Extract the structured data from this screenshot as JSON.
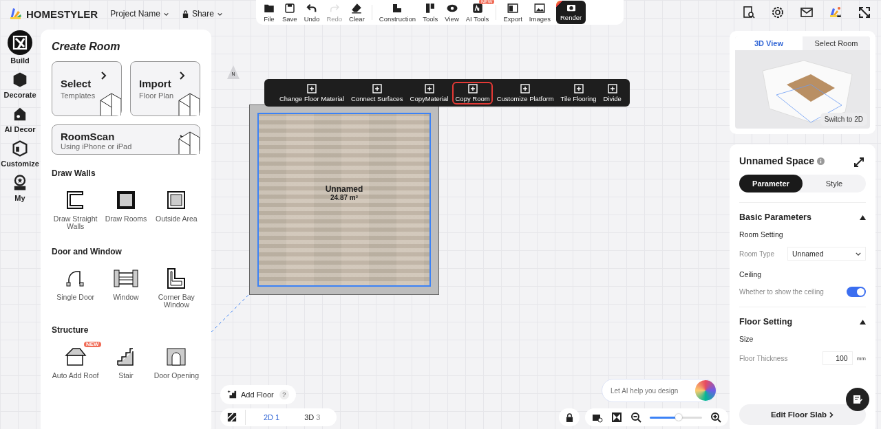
{
  "header": {
    "brand": "HOMESTYLER",
    "project": "Project Name",
    "share": "Share"
  },
  "toolbar": [
    {
      "label": "File",
      "disabled": false,
      "kind": "tool"
    },
    {
      "label": "Save",
      "disabled": false,
      "kind": "tool"
    },
    {
      "label": "Undo",
      "disabled": false,
      "kind": "tool"
    },
    {
      "label": "Redo",
      "disabled": true,
      "kind": "tool"
    },
    {
      "label": "Clear",
      "disabled": false,
      "kind": "tool"
    },
    {
      "label": "Construction",
      "disabled": false,
      "kind": "tool"
    },
    {
      "label": "Tools",
      "disabled": false,
      "kind": "tool"
    },
    {
      "label": "View",
      "disabled": false,
      "kind": "tool"
    },
    {
      "label": "AI Tools",
      "disabled": false,
      "kind": "tool",
      "badge": "NEW"
    },
    {
      "label": "Export",
      "disabled": false,
      "kind": "tool"
    },
    {
      "label": "Images",
      "disabled": false,
      "kind": "tool"
    },
    {
      "label": "Render",
      "disabled": false,
      "kind": "render"
    }
  ],
  "nav": [
    {
      "label": "Build",
      "selected": true
    },
    {
      "label": "Decorate",
      "selected": false
    },
    {
      "label": "AI Decor",
      "selected": false
    },
    {
      "label": "Customize",
      "selected": false
    },
    {
      "label": "My",
      "selected": false
    }
  ],
  "panel": {
    "title": "Create Room",
    "cards": [
      {
        "title": "Select",
        "subtitle": "Templates"
      },
      {
        "title": "Import",
        "subtitle": "Floor Plan"
      },
      {
        "title": "RoomScan",
        "subtitle": "Using iPhone or iPad"
      }
    ],
    "sections": [
      {
        "title": "Draw Walls",
        "items": [
          {
            "label": "Draw Straight Walls"
          },
          {
            "label": "Draw Rooms"
          },
          {
            "label": "Outside Area"
          }
        ]
      },
      {
        "title": "Door and Window",
        "items": [
          {
            "label": "Single Door"
          },
          {
            "label": "Window"
          },
          {
            "label": "Corner Bay Window"
          }
        ]
      },
      {
        "title": "Structure",
        "items": [
          {
            "label": "Auto Add Roof",
            "badge": "NEW"
          },
          {
            "label": "Stair"
          },
          {
            "label": "Door Opening"
          }
        ]
      }
    ]
  },
  "canvas": {
    "compass": "N",
    "room": {
      "name": "Unnamed",
      "area": "24.87 m²"
    },
    "context_toolbar": [
      {
        "label": "Change Floor Material",
        "selected": false
      },
      {
        "label": "Connect Surfaces",
        "selected": false
      },
      {
        "label": "CopyMaterial",
        "selected": false
      },
      {
        "label": "Copy Room",
        "selected": true
      },
      {
        "label": "Customize Platform",
        "selected": false
      },
      {
        "label": "Tile Flooring",
        "selected": false
      },
      {
        "label": "Divide",
        "selected": false
      }
    ]
  },
  "bottom": {
    "add_floor": "Add Floor",
    "help": "?",
    "views": [
      {
        "label": "2D",
        "count": "1",
        "selected": true
      },
      {
        "label": "3D",
        "count": "3",
        "selected": false
      }
    ],
    "ai_placeholder": "Let AI help you design",
    "zoom": {
      "level": 0.55
    }
  },
  "preview": {
    "tabs": [
      {
        "label": "3D View",
        "selected": true
      },
      {
        "label": "Select Room",
        "selected": false
      }
    ],
    "switch": "Switch to 2D"
  },
  "properties": {
    "title": "Unnamed Space",
    "tabs": [
      {
        "label": "Parameter",
        "selected": true
      },
      {
        "label": "Style",
        "selected": false
      }
    ],
    "sections": [
      {
        "title": "Basic Parameters",
        "expanded": true,
        "rows": [
          {
            "kind": "heading",
            "label": "Room Setting"
          },
          {
            "kind": "select",
            "label": "Room Type",
            "value": "Unnamed"
          },
          {
            "kind": "heading",
            "label": "Ceiling"
          },
          {
            "kind": "toggle",
            "label": "Whether to show the ceiling",
            "on": true
          }
        ]
      },
      {
        "title": "Floor Setting",
        "expanded": true,
        "rows": [
          {
            "kind": "heading",
            "label": "Size"
          },
          {
            "kind": "number",
            "label": "Floor Thickness",
            "value": "100",
            "unit": "mm"
          }
        ]
      }
    ],
    "action": "Edit Floor Slab"
  }
}
